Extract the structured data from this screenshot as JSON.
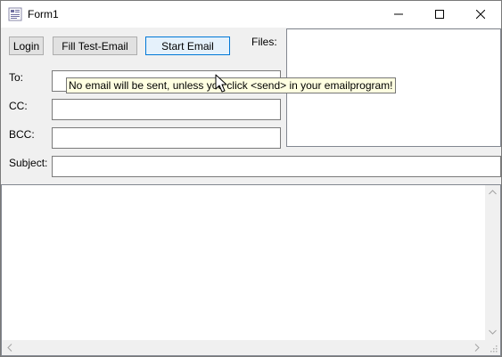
{
  "window": {
    "title": "Form1"
  },
  "toolbar": {
    "login_label": "Login",
    "fill_test_label": "Fill Test-Email",
    "start_email_label": "Start Email"
  },
  "files": {
    "label": "Files:"
  },
  "fields": {
    "to_label": "To:",
    "cc_label": "CC:",
    "bcc_label": "BCC:",
    "subject_label": "Subject:",
    "to_value": "",
    "cc_value": "",
    "bcc_value": "",
    "subject_value": ""
  },
  "tooltip": {
    "text": "No email will be sent, unless you click <send> in your emailprogram!"
  },
  "body": {
    "value": ""
  },
  "icons": [
    "app-icon",
    "minimize-icon",
    "maximize-icon",
    "close-icon",
    "scroll-up-icon",
    "scroll-down-icon",
    "scroll-left-icon",
    "scroll-right-icon",
    "size-grip-icon",
    "mouse-cursor-icon"
  ]
}
